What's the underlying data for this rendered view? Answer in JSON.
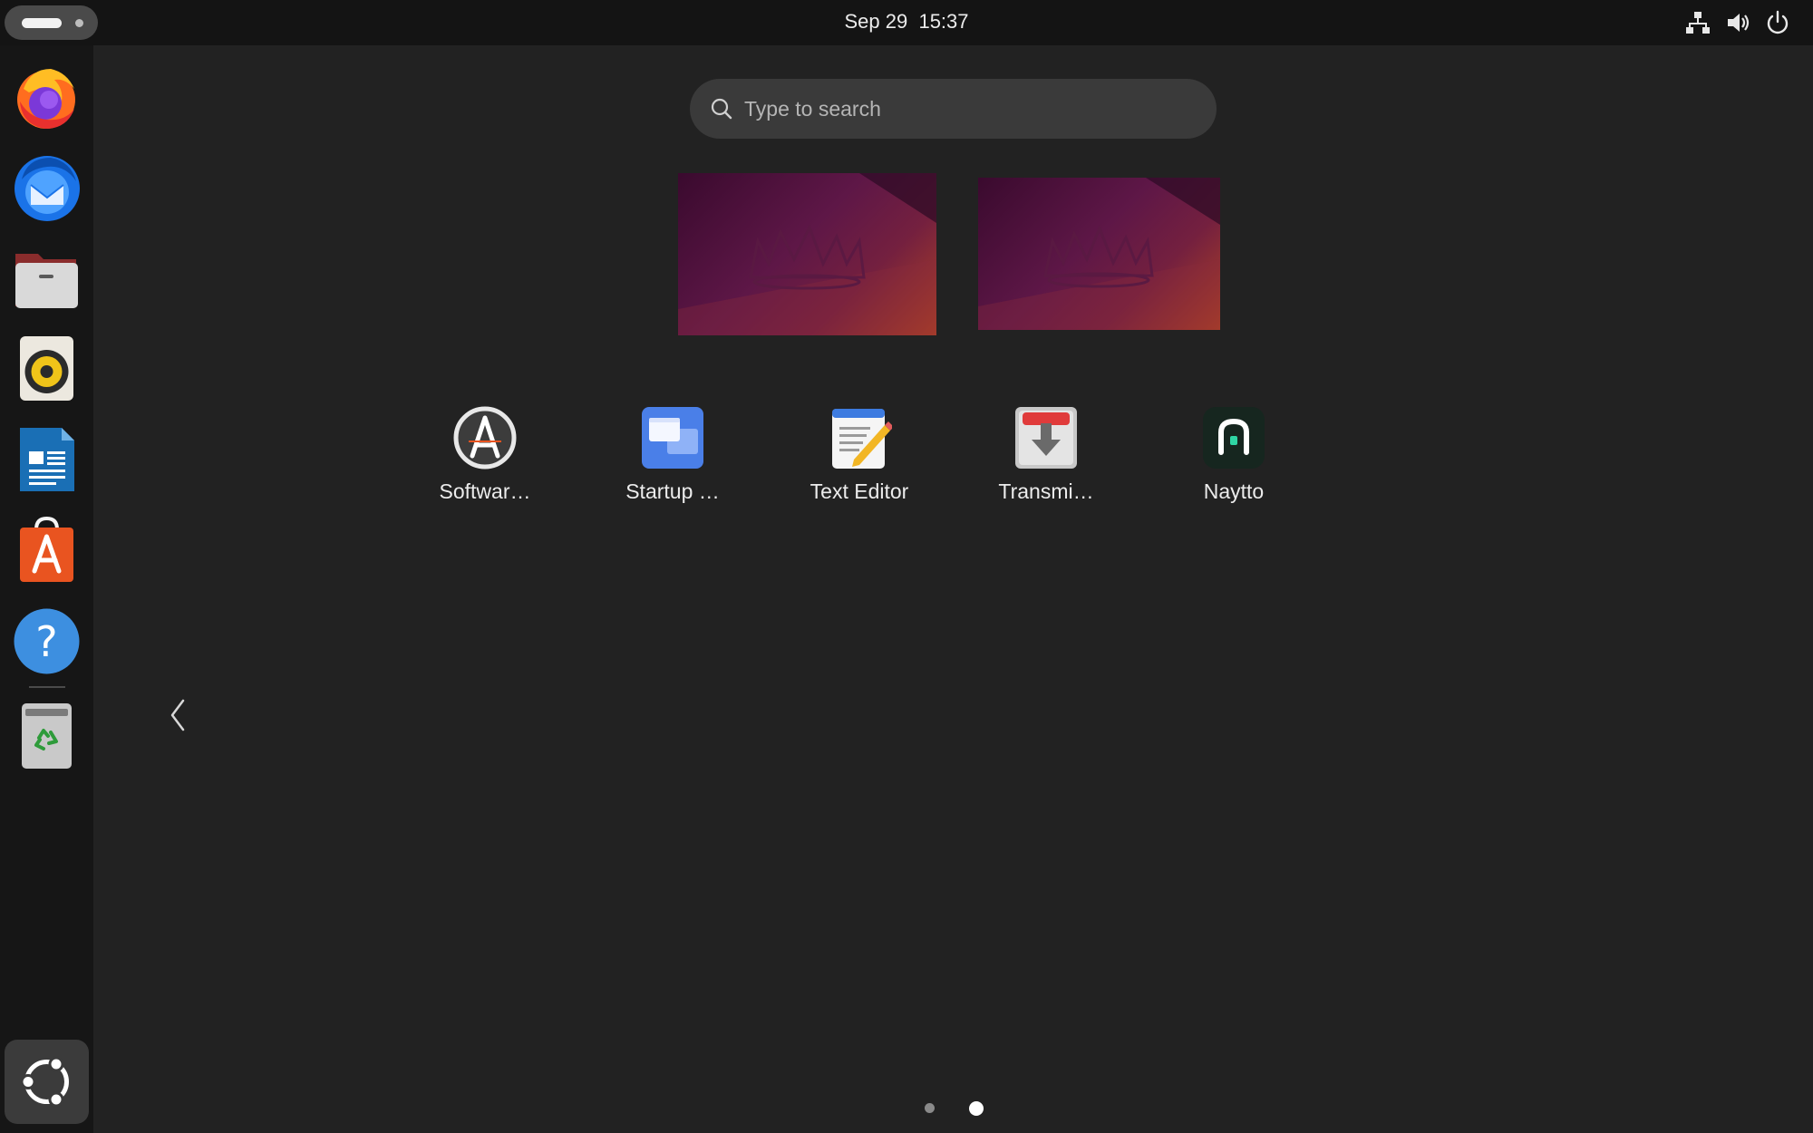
{
  "topbar": {
    "activities_icon": "activities-pill-icon",
    "clock_date": "Sep 29",
    "clock_time": "15:37",
    "tray": [
      "network-icon",
      "volume-icon",
      "power-icon"
    ]
  },
  "dock": {
    "apps": [
      {
        "name": "firefox",
        "icon": "firefox-icon"
      },
      {
        "name": "thunderbird",
        "icon": "thunderbird-icon"
      },
      {
        "name": "files",
        "icon": "files-folder-icon"
      },
      {
        "name": "rhythmbox",
        "icon": "rhythmbox-speaker-icon"
      },
      {
        "name": "libreoffice-writer",
        "icon": "writer-document-icon"
      },
      {
        "name": "app-center",
        "icon": "app-center-bag-icon"
      },
      {
        "name": "help",
        "icon": "help-question-icon"
      },
      {
        "name": "trash",
        "icon": "trash-recycle-icon"
      }
    ],
    "show_apps_icon": "ubuntu-logo-icon"
  },
  "search": {
    "placeholder": "Type to search",
    "value": "",
    "icon": "search-icon"
  },
  "app_grid": {
    "apps": [
      {
        "label": "Softwar…",
        "icon": "software-updater-icon"
      },
      {
        "label": "Startup …",
        "icon": "startup-applications-icon"
      },
      {
        "label": "Text Editor",
        "icon": "text-editor-icon"
      },
      {
        "label": "Transmi…",
        "icon": "transmission-icon"
      },
      {
        "label": "Naytto",
        "icon": "naytto-icon"
      }
    ],
    "page_count": 2,
    "current_page": 2
  },
  "colors": {
    "background": "#222222",
    "topbar": "#141414",
    "dock": "#161616",
    "search_bg": "#3a3a3a"
  }
}
